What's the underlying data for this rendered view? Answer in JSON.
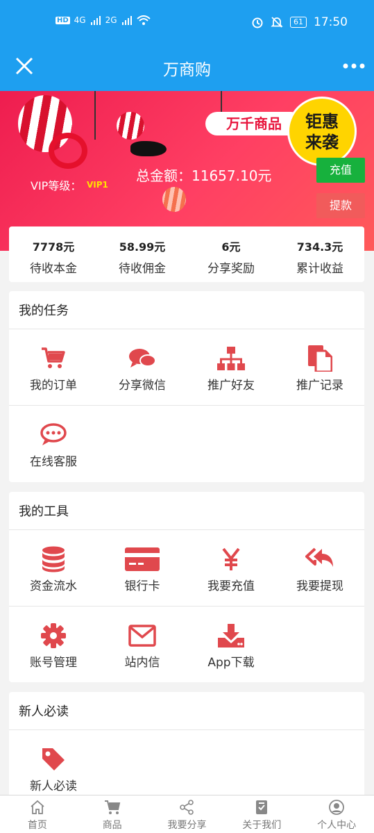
{
  "status_bar": {
    "network": "4G",
    "network2": "2G",
    "battery": "61",
    "time": "17:50"
  },
  "header": {
    "title": "万商购"
  },
  "banner": {
    "sale_tag": "万千商品",
    "sale_line1": "钜惠",
    "sale_line2": "来袭",
    "vip_label": "VIP等级：",
    "vip_level": "VIP1",
    "total_amount": "总金额：11657.10元",
    "recharge_label": "充值",
    "withdraw_label": "提款"
  },
  "stats": [
    {
      "value": "7778元",
      "label": "待收本金"
    },
    {
      "value": "58.99元",
      "label": "待收佣金"
    },
    {
      "value": "6元",
      "label": "分享奖励"
    },
    {
      "value": "734.3元",
      "label": "累计收益"
    }
  ],
  "tasks": {
    "title": "我的任务",
    "items": [
      {
        "label": "我的订单",
        "icon": "cart-icon"
      },
      {
        "label": "分享微信",
        "icon": "chat-bubbles-icon"
      },
      {
        "label": "推广好友",
        "icon": "sitemap-icon"
      },
      {
        "label": "推广记录",
        "icon": "document-icon"
      },
      {
        "label": "在线客服",
        "icon": "comment-dots-icon"
      }
    ]
  },
  "tools": {
    "title": "我的工具",
    "items": [
      {
        "label": "资金流水",
        "icon": "database-icon"
      },
      {
        "label": "银行卡",
        "icon": "credit-card-icon"
      },
      {
        "label": "我要充值",
        "icon": "yen-icon"
      },
      {
        "label": "我要提现",
        "icon": "reply-all-icon"
      },
      {
        "label": "账号管理",
        "icon": "gear-icon"
      },
      {
        "label": "站内信",
        "icon": "envelope-icon"
      },
      {
        "label": "App下载",
        "icon": "download-icon"
      }
    ]
  },
  "newbie": {
    "title": "新人必读",
    "items": [
      {
        "label": "新人必读",
        "icon": "tag-icon"
      }
    ]
  },
  "bottom_nav": [
    {
      "label": "首页",
      "icon": "home-icon"
    },
    {
      "label": "商品",
      "icon": "cart-icon"
    },
    {
      "label": "我要分享",
      "icon": "share-icon"
    },
    {
      "label": "关于我们",
      "icon": "checklist-icon"
    },
    {
      "label": "个人中心",
      "icon": "user-circle-icon"
    }
  ],
  "colors": {
    "brand_blue": "#1e9ff0",
    "icon_red": "#e0484d",
    "recharge_green": "#17b13d",
    "withdraw_red": "#f15b5b"
  }
}
